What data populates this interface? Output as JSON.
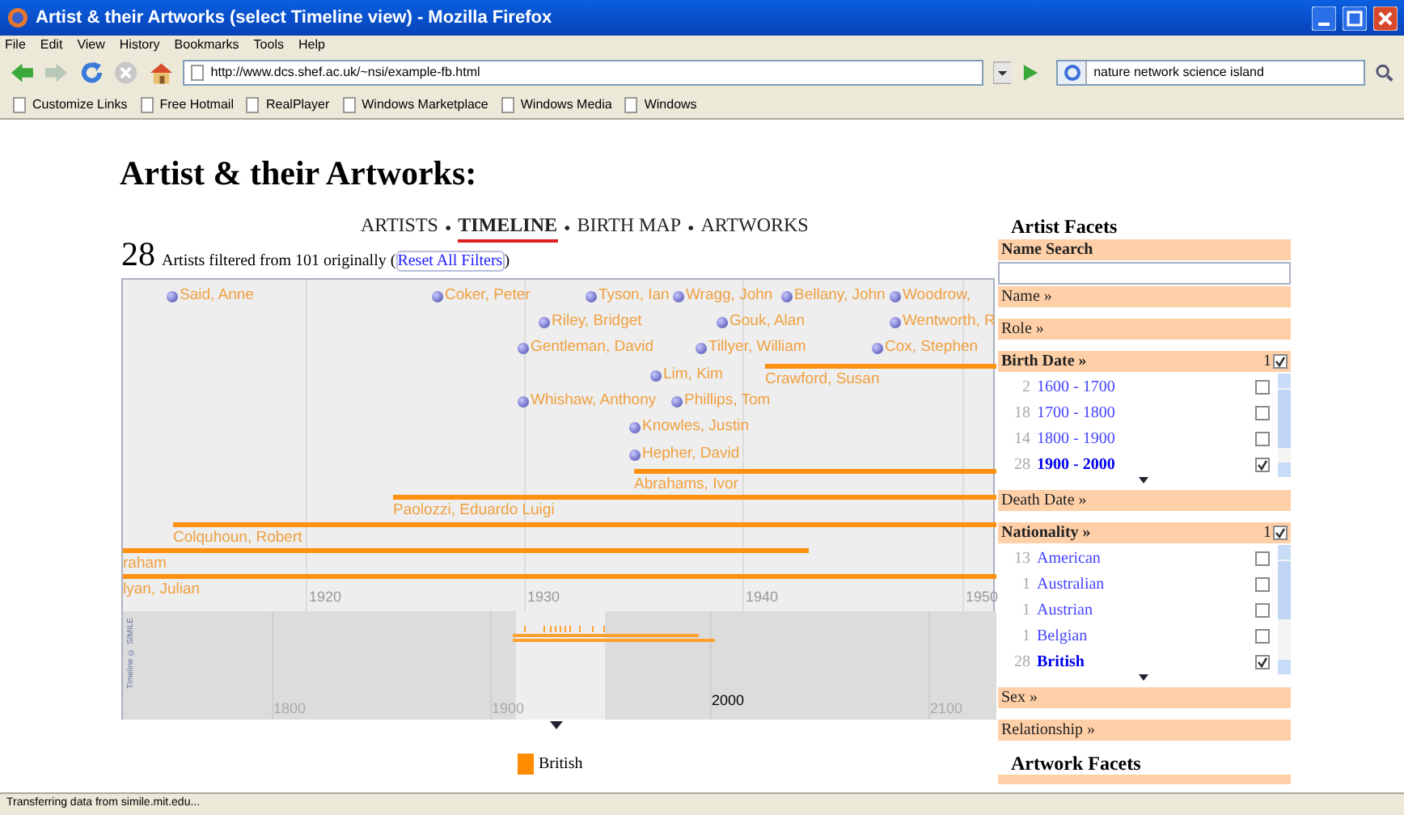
{
  "window": {
    "title": "Artist & their Artworks (select Timeline view) - Mozilla Firefox"
  },
  "menu": [
    "File",
    "Edit",
    "View",
    "History",
    "Bookmarks",
    "Tools",
    "Help"
  ],
  "toolbar": {
    "url": "http://www.dcs.shef.ac.uk/~nsi/example-fb.html",
    "search": "nature network science island"
  },
  "bookmarks": [
    "Customize Links",
    "Free Hotmail",
    "RealPlayer",
    "Windows Marketplace",
    "Windows Media",
    "Windows"
  ],
  "page": {
    "heading": "Artist & their Artworks:",
    "views": [
      {
        "label": "ARTISTS",
        "selected": false
      },
      {
        "label": "TIMELINE",
        "selected": true
      },
      {
        "label": "BIRTH MAP",
        "selected": false
      },
      {
        "label": "ARTWORKS",
        "selected": false
      }
    ],
    "separator": "•",
    "count": "28",
    "summary_before": "Artists filtered from 101 originally (",
    "reset_link": "Reset All Filters",
    "summary_after": ")"
  },
  "timeline": {
    "events": [
      {
        "label": "Said, Anne",
        "kind": "point"
      },
      {
        "label": "Coker, Peter",
        "kind": "point"
      },
      {
        "label": "Tyson, Ian",
        "kind": "point"
      },
      {
        "label": "Wragg, John",
        "kind": "point"
      },
      {
        "label": "Bellany, John",
        "kind": "point"
      },
      {
        "label": "Woodrow,",
        "kind": "point"
      },
      {
        "label": "Riley, Bridget",
        "kind": "point"
      },
      {
        "label": "Gouk, Alan",
        "kind": "point"
      },
      {
        "label": "Wentworth, R",
        "kind": "point"
      },
      {
        "label": "Gentleman, David",
        "kind": "point"
      },
      {
        "label": "Tillyer, William",
        "kind": "point"
      },
      {
        "label": "Cox, Stephen",
        "kind": "point"
      },
      {
        "label": "Lim, Kim",
        "kind": "point"
      },
      {
        "label": "Crawford, Susan",
        "kind": "span"
      },
      {
        "label": "Whishaw, Anthony",
        "kind": "point"
      },
      {
        "label": "Phillips, Tom",
        "kind": "point"
      },
      {
        "label": "Knowles, Justin",
        "kind": "point"
      },
      {
        "label": "Hepher, David",
        "kind": "point"
      },
      {
        "label": "Abrahams, Ivor",
        "kind": "span"
      },
      {
        "label": "Paolozzi, Eduardo Luigi",
        "kind": "span"
      },
      {
        "label": "Colquhoun, Robert",
        "kind": "span"
      },
      {
        "label": "raham",
        "kind": "span"
      },
      {
        "label": "lyan, Julian",
        "kind": "span"
      }
    ],
    "ticks": [
      "1920",
      "1930",
      "1940",
      "1950"
    ],
    "overview_ticks": [
      "1800",
      "1900",
      "2100"
    ],
    "overview_marker": "2000",
    "credit": "Timeline © SIMILE"
  },
  "legend": [
    {
      "label": "British",
      "color": "#ff8c00"
    }
  ],
  "facets": {
    "title": "Artist Facets",
    "sections": [
      {
        "kind": "search",
        "label": "Name Search"
      },
      {
        "kind": "collapsed",
        "label": "Name »"
      },
      {
        "kind": "collapsed",
        "label": "Role »"
      },
      {
        "kind": "list",
        "label": "Birth Date »",
        "selected_count": "1",
        "filter_checked": true,
        "items": [
          {
            "count": "2",
            "label": "1600 - 1700",
            "checked": false
          },
          {
            "count": "18",
            "label": "1700 - 1800",
            "checked": false
          },
          {
            "count": "14",
            "label": "1800 - 1900",
            "checked": false
          },
          {
            "count": "28",
            "label": "1900 - 2000",
            "checked": true
          }
        ]
      },
      {
        "kind": "collapsed",
        "label": "Death Date »"
      },
      {
        "kind": "list",
        "label": "Nationality »",
        "selected_count": "1",
        "filter_checked": true,
        "items": [
          {
            "count": "13",
            "label": "American",
            "checked": false
          },
          {
            "count": "1",
            "label": "Australian",
            "checked": false
          },
          {
            "count": "1",
            "label": "Austrian",
            "checked": false
          },
          {
            "count": "1",
            "label": "Belgian",
            "checked": false
          },
          {
            "count": "28",
            "label": "British",
            "checked": true
          }
        ]
      },
      {
        "kind": "collapsed",
        "label": "Sex »"
      },
      {
        "kind": "collapsed",
        "label": "Relationship »"
      }
    ],
    "second_title": "Artwork Facets"
  },
  "status_bar": "Transferring data from simile.mit.edu..."
}
